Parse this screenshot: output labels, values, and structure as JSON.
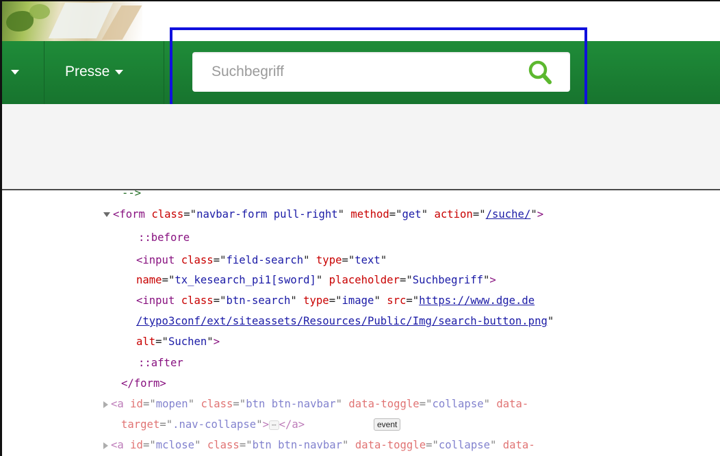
{
  "navbar": {
    "presse_label": "Presse",
    "accent_color": "#1f8c39",
    "highlight_color": "#1010dd"
  },
  "search": {
    "placeholder": "Suchbegriff",
    "value": "",
    "button_icon": "search-icon",
    "icon_color": "#5cb82f"
  },
  "devtools": {
    "line_comment": "-->",
    "form_open": {
      "tag": "form",
      "attrs": [
        {
          "name": "class",
          "value": "navbar-form pull-right"
        },
        {
          "name": "method",
          "value": "get"
        },
        {
          "name": "action",
          "value": "/suche/"
        }
      ]
    },
    "pseudo_before": "::before",
    "input1": {
      "line1": {
        "tag": "input",
        "class_value": "field-search",
        "type_value": "text"
      },
      "line2": {
        "name_value": "tx_kesearch_pi1[sword]",
        "placeholder_value": "Suchbegriff"
      }
    },
    "input2": {
      "tag": "input",
      "class_value": "btn-search",
      "type_value": "image",
      "src_part1": "https://www.dge.de",
      "src_part2": "/typo3conf/ext/siteassets/Resources/Public/Img/search-button.png",
      "alt_value": "Suchen"
    },
    "pseudo_after": "::after",
    "form_close": "</form>",
    "anchor1": {
      "id_value": "mopen",
      "class_value": "btn btn-navbar",
      "toggle_value": "collapse",
      "target_value": ".nav-collapse",
      "event_label": "event"
    },
    "anchor2": {
      "id_value": "mclose",
      "class_value": "btn btn-navbar",
      "toggle_value": "collapse"
    }
  }
}
